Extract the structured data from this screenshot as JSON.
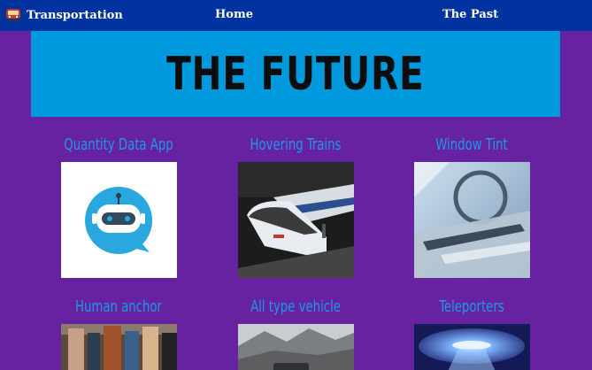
{
  "navbar": {
    "brand_label": "Transportation",
    "links": [
      {
        "label": "Home"
      },
      {
        "label": "The Past"
      }
    ]
  },
  "hero": {
    "title": "THE FUTURE"
  },
  "cards": [
    {
      "title": "Quantity Data App",
      "image": "chatbot-robot-logo"
    },
    {
      "title": "Hovering Trains",
      "image": "bullet-trains-photo"
    },
    {
      "title": "Window Tint",
      "image": "car-interior-window-photo"
    },
    {
      "title": "Human anchor",
      "image": "people-crowd-photo"
    },
    {
      "title": "All type vehicle",
      "image": "vehicle-on-mountain-photo"
    },
    {
      "title": "Teleporters",
      "image": "ufo-beam-photo"
    }
  ],
  "colors": {
    "background": "#6622a0",
    "navbar": "#0033a0",
    "hero": "#0099dd",
    "card_title": "#1a9be6"
  }
}
